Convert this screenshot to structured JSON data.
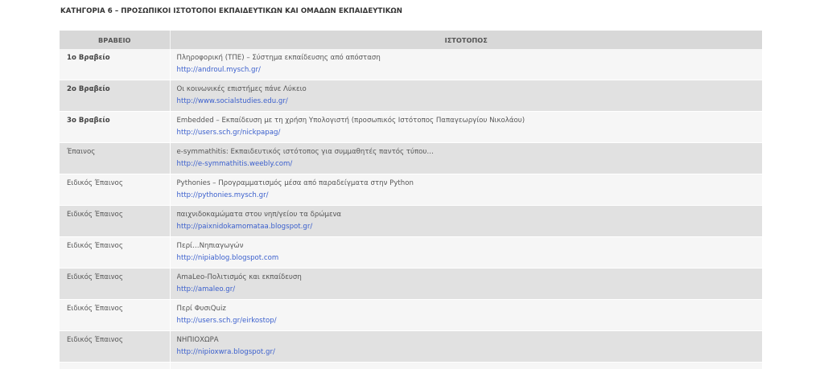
{
  "category_title": "ΚΑΤΗΓΟΡΙΑ 6 – ΠΡΟΣΩΠΙΚΟΙ ΙΣΤΟΤΟΠΟΙ ΕΚΠΑΙΔΕΥΤΙΚΩΝ ΚΑΙ ΟΜΑΔΩΝ ΕΚΠΑΙΔΕΥΤΙΚΩΝ",
  "table": {
    "headers": {
      "award": "ΒΡΑΒΕΙΟ",
      "site": "ΙΣΤΟΤΟΠΟΣ"
    },
    "rows": [
      {
        "award": "1ο Βραβείο",
        "strong": true,
        "title": "Πληροφορική (ΤΠΕ) – Σύστημα εκπαίδευσης από απόσταση",
        "url": "http://androul.mysch.gr/"
      },
      {
        "award": "2ο Βραβείο",
        "strong": true,
        "title": "Οι κοινωνικές επιστήμες πάνε Λύκειο",
        "url": "http://www.socialstudies.edu.gr/"
      },
      {
        "award": "3ο Βραβείο",
        "strong": true,
        "title": "Embedded – Εκπαίδευση με τη χρήση Υπολογιστή (προσωπικός Ιστότοπος Παπαγεωργίου Νικολάου)",
        "url": "http://users.sch.gr/nickpapag/"
      },
      {
        "award": "Έπαινος",
        "strong": false,
        "title": "e-symmathitis: Εκπαιδευτικός ιστότοπος για συμμαθητές παντός τύπου…",
        "url": "http://e-symmathitis.weebly.com/"
      },
      {
        "award": "Ειδικός Έπαινος",
        "strong": false,
        "title": "Pythonies – Προγραμματισμός μέσα από παραδείγματα στην Python",
        "url": "http://pythonies.mysch.gr/"
      },
      {
        "award": "Ειδικός Έπαινος",
        "strong": false,
        "title": "παιχνιδοκαμώματα στου νηπ/γείου τα δρώμενα",
        "url": "http://paixnidokamomataa.blogspot.gr/"
      },
      {
        "award": "Ειδικός Έπαινος",
        "strong": false,
        "title": "Περί…Νηπιαγωγών",
        "url": "http://nipiablog.blogspot.com"
      },
      {
        "award": "Ειδικός Έπαινος",
        "strong": false,
        "title": "AmaLeo-Πολιτισμός και εκπαίδευση",
        "url": "http://amaleo.gr/"
      },
      {
        "award": "Ειδικός Έπαινος",
        "strong": false,
        "title": "Περί ΦυσιQuiz",
        "url": "http://users.sch.gr/eirkostop/"
      },
      {
        "award": "Ειδικός Έπαινος",
        "strong": false,
        "title": "ΝΗΠΙΟΧΩΡΑ",
        "url": "http://nipioxwra.blogspot.gr/"
      }
    ]
  },
  "colors": {
    "header_bg": "#d8d8d8",
    "row_odd_bg": "#f6f6f6",
    "row_even_bg": "#e1e1e1",
    "link": "#3a5fcd",
    "text": "#555555"
  }
}
